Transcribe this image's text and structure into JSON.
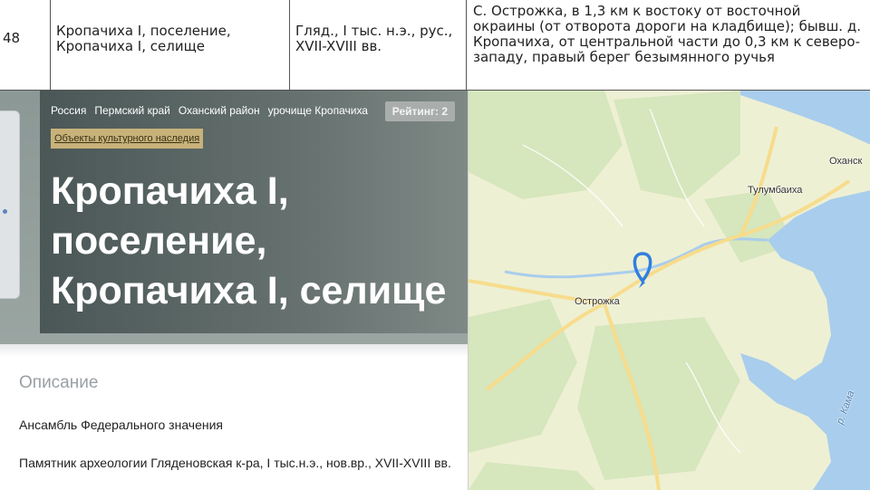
{
  "table": {
    "number": "48",
    "object_name": "Кропачиха I, поселение, Кропачиха I, селище",
    "dating": "Гляд., I тыс. н.э., рус., XVII-XVIII вв.",
    "location": "С. Острожка, в 1,3 км к востоку от восточной окраины (от отворота дороги на кладбище); бывш. д. Кропачиха, от центральной части до 0,3 км к северо-западу, правый берег безымянного ручья"
  },
  "page": {
    "breadcrumb": [
      "Россия",
      "Пермский край",
      "Оханский район",
      "урочище Кропачиха"
    ],
    "rating": "Рейтинг: 2",
    "category": "Объекты культурного наследия",
    "title": "Кропачиха I, поселение, Кропачиха I, селище",
    "description_heading": "Описание",
    "description_lines": [
      "Ансамбль Федерального значения",
      "Памятник археологии Гляденовская к-ра, I тыс.н.э., нов.вр., XVII-XVIII вв."
    ]
  },
  "map": {
    "labels": {
      "okhansk": "Оханск",
      "tulumbaikha": "Тулумбаиха",
      "ostrozhka": "Острожка",
      "kama": "р. Кама"
    },
    "colors": {
      "water": "#a9cdec",
      "land": "#eef0d4",
      "forest": "#d6e6bd",
      "road": "#f7dc8c",
      "pin": "#2f7fe0"
    },
    "pin_icon": "location-pin-icon"
  }
}
